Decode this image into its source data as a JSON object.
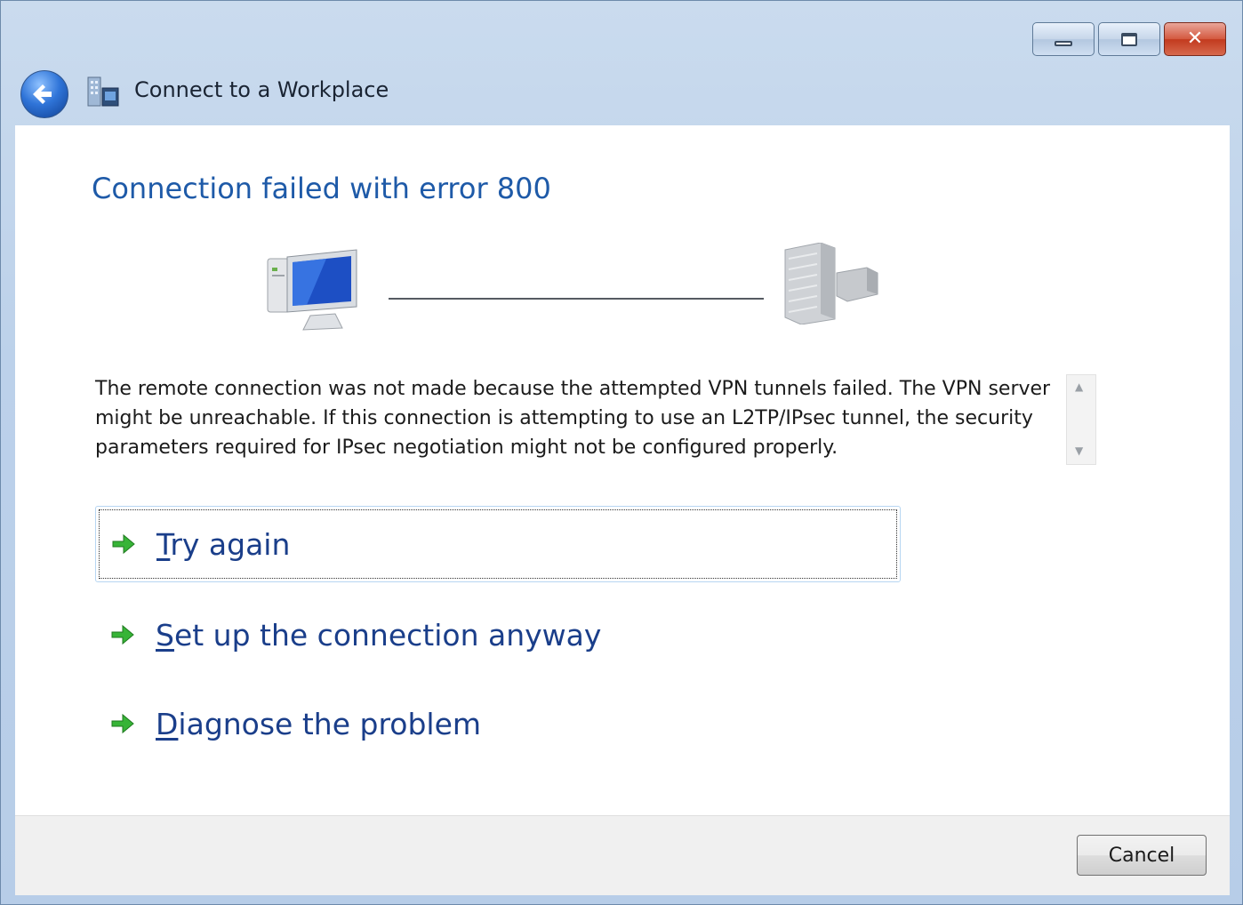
{
  "window": {
    "title": "Connect to a Workplace",
    "controls": {
      "minimize": "minimize",
      "maximize": "maximize",
      "close": "close"
    }
  },
  "main": {
    "heading": "Connection failed with error 800",
    "message": "The remote connection was not made because the attempted VPN tunnels failed. The VPN server might be unreachable. If this connection is attempting to use an L2TP/IPsec tunnel, the security parameters required for IPsec negotiation might not be configured properly.",
    "options": [
      {
        "accel": "T",
        "rest": "ry again"
      },
      {
        "accel": "S",
        "rest": "et up the connection anyway"
      },
      {
        "accel": "D",
        "rest": "iagnose the problem"
      }
    ]
  },
  "footer": {
    "cancel_label": "Cancel"
  },
  "icons": {
    "back": "back-arrow-icon",
    "app": "workplace-icon",
    "client": "computer-icon",
    "server": "server-building-icon",
    "option_arrow": "green-arrow-icon"
  },
  "colors": {
    "heading": "#1e5aa8",
    "link": "#1a3e8a",
    "arrow": "#2fa52f",
    "titlebar": "#bcd1ea"
  }
}
